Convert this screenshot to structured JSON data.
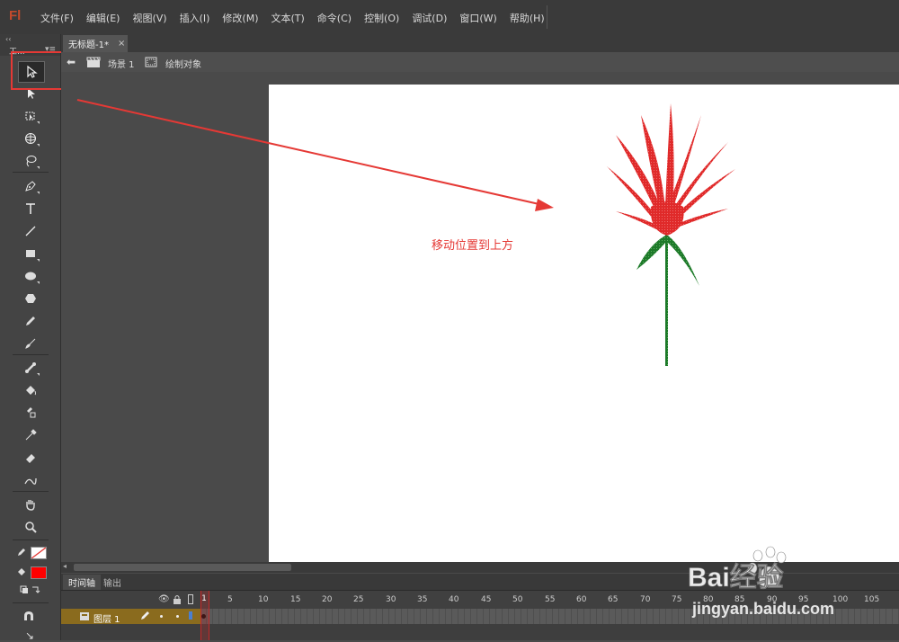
{
  "app": {
    "logo": "Fl"
  },
  "menu": [
    "文件(F)",
    "编辑(E)",
    "视图(V)",
    "插入(I)",
    "修改(M)",
    "文本(T)",
    "命令(C)",
    "控制(O)",
    "调试(D)",
    "窗口(W)",
    "帮助(H)"
  ],
  "toolbox": {
    "title": "工...",
    "collapse": "‹‹",
    "menu_icon": "▾≡"
  },
  "document": {
    "tab_label": "无标题-1*",
    "close": "×"
  },
  "editbar": {
    "scene_label": "场景 1",
    "object_label": "绘制对象"
  },
  "stage": {
    "annotation": "移动位置到上方"
  },
  "timeline": {
    "tabs": [
      "时间轴",
      "输出"
    ],
    "layer_name": "图层 1",
    "playhead_frame": "1",
    "frame_numbers": [
      "5",
      "10",
      "15",
      "20",
      "25",
      "30",
      "35",
      "40",
      "45",
      "50",
      "55",
      "60",
      "65",
      "70",
      "75",
      "80",
      "85",
      "90",
      "95",
      "100",
      "105"
    ]
  },
  "watermark": {
    "brand": "Bai经验",
    "url": "jingyan.baidu.com"
  },
  "colors": {
    "annotation": "#e53935",
    "fill_color": "#ff0000",
    "flower_red": "#e02a2a",
    "stem_green": "#1e7a2a"
  }
}
